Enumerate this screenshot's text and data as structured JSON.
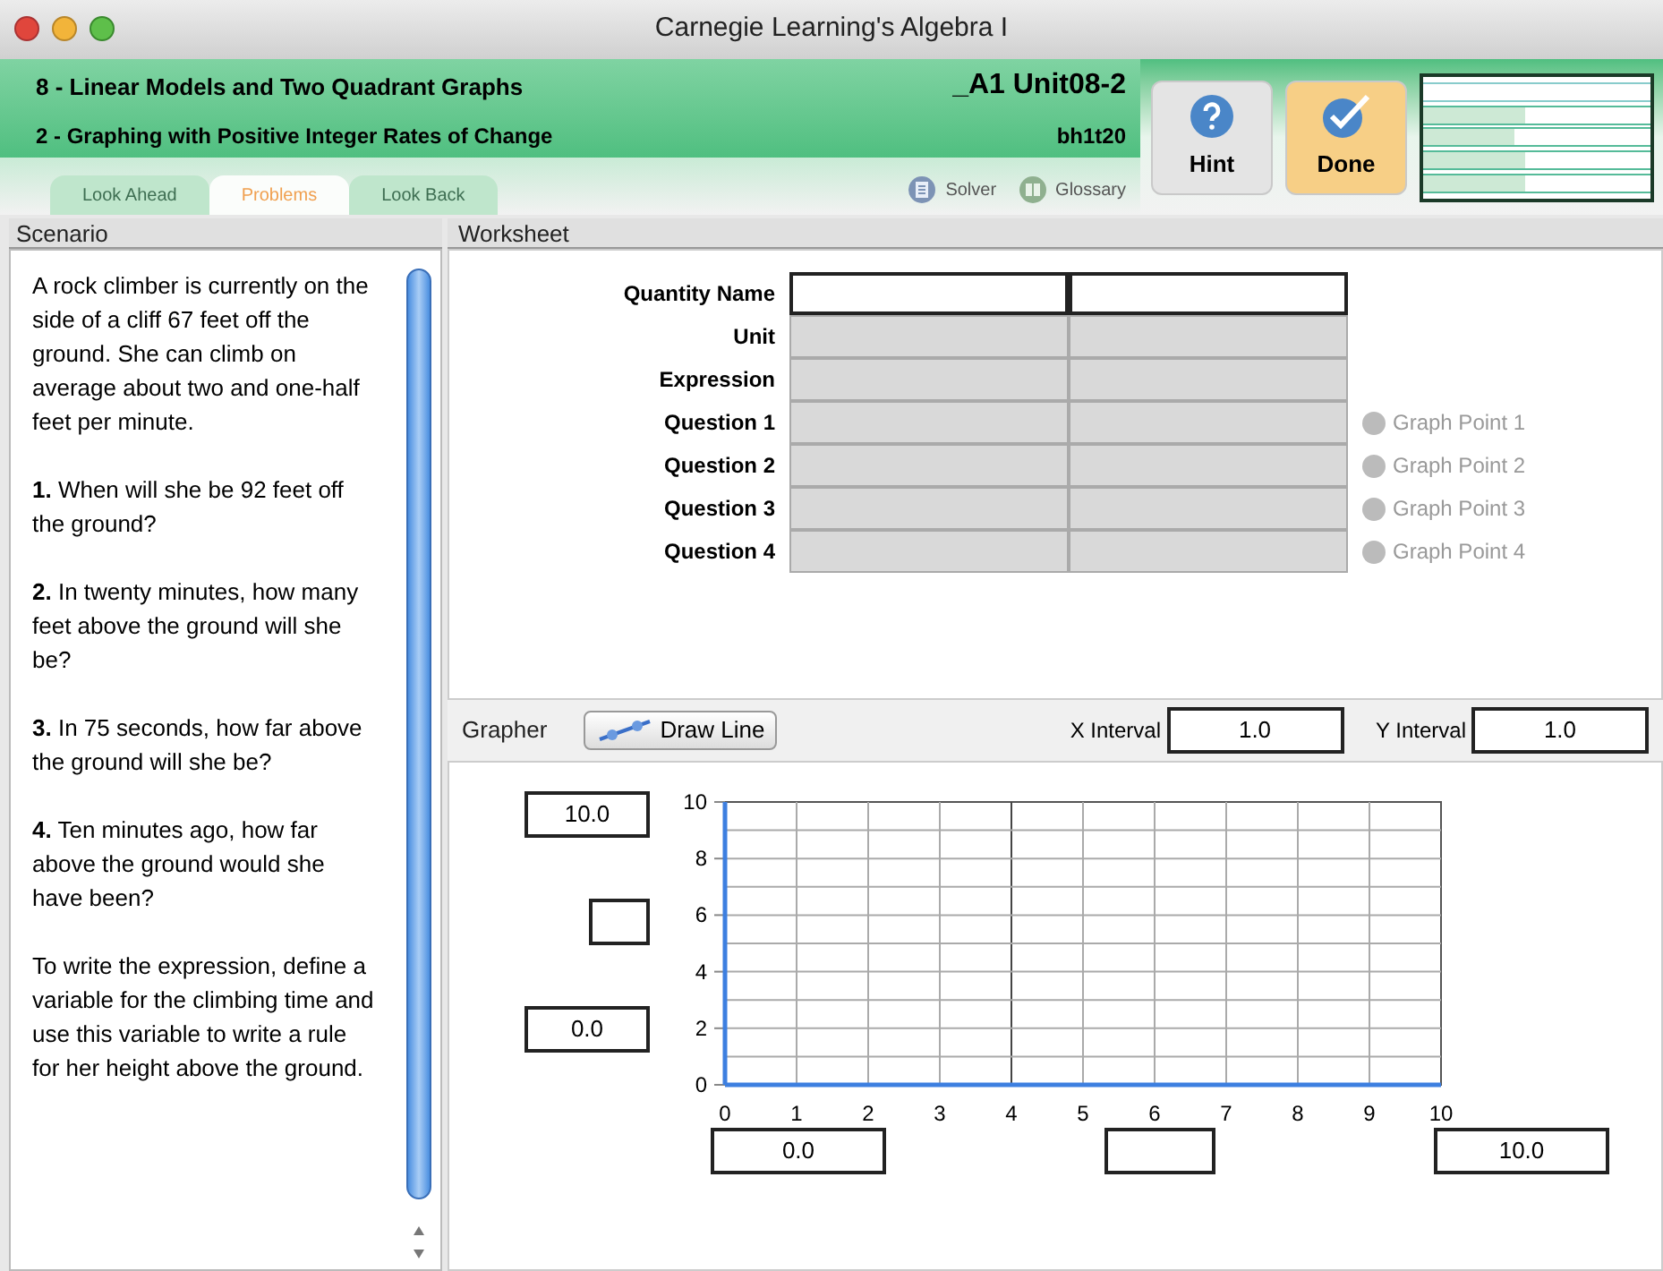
{
  "window": {
    "title": "Carnegie Learning's Algebra I"
  },
  "header": {
    "unit": "8 - Linear Models and Two Quadrant Graphs",
    "section": "2 - Graphing with Positive Integer Rates of Change",
    "code": "_A1 Unit08-2",
    "problem_id": "bh1t20"
  },
  "tabs": [
    {
      "label": "Look Ahead",
      "selected": false
    },
    {
      "label": "Problems",
      "selected": true
    },
    {
      "label": "Look Back",
      "selected": false
    }
  ],
  "tools": [
    {
      "label": "Solver",
      "kind": "solver"
    },
    {
      "label": "Glossary",
      "kind": "glossary"
    }
  ],
  "buttons": [
    {
      "label": "Hint",
      "kind": "hint"
    },
    {
      "label": "Done",
      "kind": "done"
    }
  ],
  "skills": [
    {
      "kind": "empty"
    },
    {
      "kind": "progress",
      "level": 0.45
    },
    {
      "kind": "progress",
      "level": 0.4
    },
    {
      "kind": "progress",
      "level": 0.45
    },
    {
      "kind": "progress",
      "level": 0.45
    }
  ],
  "scenario": {
    "title": "Scenario",
    "paragraphs": [
      "A rock climber is currently on the side of a cliff 67 feet off the ground. She can climb on average about two and one-half feet per minute.",
      "**1.** When will she be 92 feet off the ground?",
      "**2.** In twenty minutes, how many feet above the ground will she be?",
      "**3.** In 75 seconds, how far above the ground will she be?",
      "**4.** Ten minutes ago, how far above the ground would she have been?",
      "To write the expression, define a variable for the climbing time and use this variable to write a rule for her height above the ground."
    ]
  },
  "worksheet": {
    "title": "Worksheet",
    "rows": [
      {
        "label": "Quantity Name",
        "kind": "input"
      },
      {
        "label": "Unit",
        "kind": "locked"
      },
      {
        "label": "Expression",
        "kind": "locked"
      },
      {
        "label": "Question 1",
        "kind": "locked",
        "graph_point": "Graph Point 1",
        "graph_point_disabled": true
      },
      {
        "label": "Question 2",
        "kind": "locked",
        "graph_point": "Graph Point 2",
        "graph_point_disabled": true
      },
      {
        "label": "Question 3",
        "kind": "locked",
        "graph_point": "Graph Point 3",
        "graph_point_disabled": true
      },
      {
        "label": "Question 4",
        "kind": "locked",
        "graph_point": "Graph Point 4",
        "graph_point_disabled": true
      }
    ]
  },
  "grapher": {
    "title": "Grapher",
    "draw_line": "Draw Line",
    "x_interval_label": "X Interval",
    "x_interval": "1.0",
    "y_interval_label": "Y Interval",
    "y_interval": "1.0",
    "y_max": "10.0",
    "y_min": "0.0",
    "x_min": "0.0",
    "x_max": "10.0",
    "x_ticks": [
      "0",
      "1",
      "2",
      "3",
      "4",
      "5",
      "6",
      "7",
      "8",
      "9",
      "10"
    ],
    "y_ticks": [
      "10",
      "8",
      "6",
      "4",
      "2",
      "0"
    ]
  }
}
